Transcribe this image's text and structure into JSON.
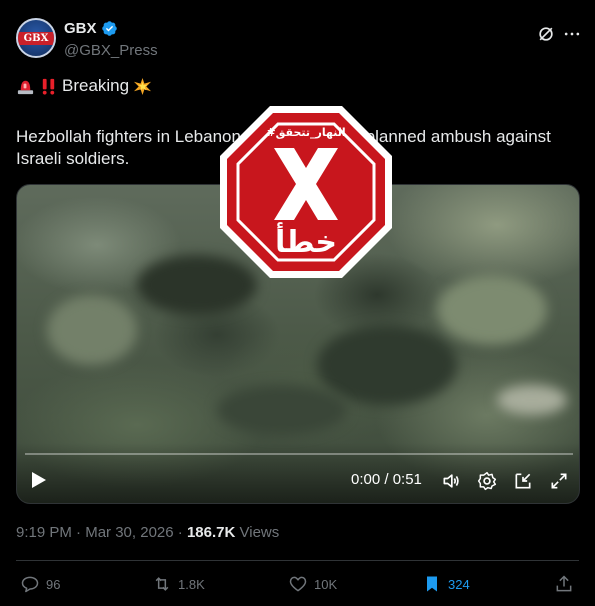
{
  "author": {
    "display_name": "GBX",
    "handle": "@GBX_Press",
    "avatar_text": "GBX"
  },
  "tweet": {
    "breaking_label": "Breaking",
    "text": "Hezbollah fighters in Lebanon carry out a well-planned ambush against Israeli soldiers."
  },
  "stamp": {
    "hashtag": "#النهار_تتحقق",
    "verdict": "خطأ"
  },
  "video": {
    "time": "0:00 / 0:51",
    "progress": 0
  },
  "meta": {
    "time": "9:19 PM",
    "date": "Mar 30, 2026",
    "views": "186.7K",
    "views_label": "Views"
  },
  "actions": {
    "replies": "96",
    "reposts": "1.8K",
    "likes": "10K",
    "bookmarks": "324"
  },
  "icons": [
    "verified-badge-icon",
    "grok-icon",
    "more-icon",
    "siren-emoji",
    "double-exclamation-emoji",
    "collision-emoji",
    "play-icon",
    "volume-icon",
    "settings-icon",
    "pip-icon",
    "fullscreen-icon",
    "reply-icon",
    "repost-icon",
    "like-icon",
    "bookmark-icon",
    "share-icon"
  ],
  "colors": {
    "background": "#000000",
    "text": "#e7e9ea",
    "muted": "#71767b",
    "accent": "#1d9bf0",
    "stamp_red": "#c8161d"
  }
}
